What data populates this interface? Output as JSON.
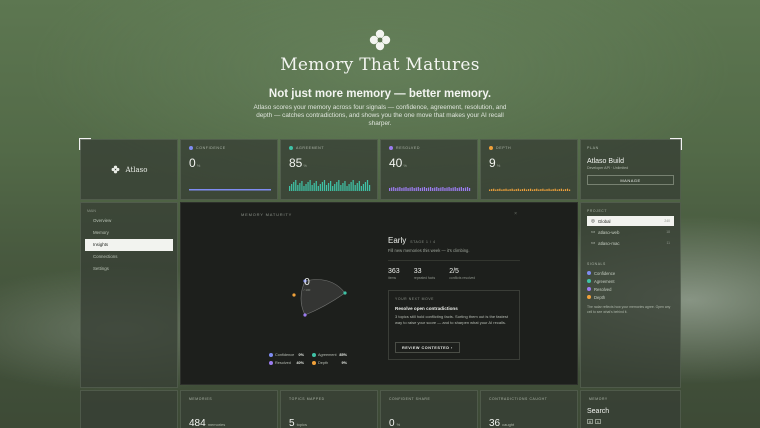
{
  "hero": {
    "title": "Memory That Matures",
    "subtitle": "Not just more memory — better memory.",
    "description": "Atlaso scores your memory across four signals — confidence, agreement, resolution, and depth — catches contradictions, and shows you the one move that makes your AI recall sharper."
  },
  "brand": {
    "name": "Atlaso",
    "logo_icon": "atlaso-logo-icon"
  },
  "metrics": [
    {
      "label": "CONFIDENCE",
      "value": "0",
      "unit": "%",
      "color": "#7f8cf2"
    },
    {
      "label": "AGREEMENT",
      "value": "85",
      "unit": "%",
      "color": "#3fc2a6"
    },
    {
      "label": "RESOLVED",
      "value": "40",
      "unit": "%",
      "color": "#9b7cf0"
    },
    {
      "label": "DEPTH",
      "value": "9",
      "unit": "%",
      "color": "#f0a13a"
    }
  ],
  "plan": {
    "label": "PLAN",
    "name": "Atlaso Build",
    "meta": "Developer API · Unlimited",
    "manage_label": "MANAGE"
  },
  "sidebar": {
    "heading": "MAIN",
    "items": [
      {
        "label": "Overview",
        "active": false
      },
      {
        "label": "Memory",
        "active": false
      },
      {
        "label": "Insights",
        "active": true
      },
      {
        "label": "Connections",
        "active": false
      },
      {
        "label": "Settings",
        "active": false
      }
    ]
  },
  "maturity": {
    "panel_label": "MEMORY MATURITY",
    "score": "0",
    "score_caption": "/ 100",
    "stage": "Early",
    "stage_meta": "STAGE 1 / 4",
    "stage_note": "Fill new memories this week — it's climbing.",
    "stats": [
      {
        "value": "363",
        "label": "items"
      },
      {
        "value": "33",
        "label": "repeated facts"
      },
      {
        "value": "2/5",
        "label": "conflicts resolved"
      }
    ],
    "legend": [
      {
        "name": "Confidence",
        "value": "0%",
        "color": "#7f8cf2"
      },
      {
        "name": "Agreement",
        "value": "85%",
        "color": "#3fc2a6"
      },
      {
        "name": "Resolved",
        "value": "40%",
        "color": "#9b7cf0"
      },
      {
        "name": "Depth",
        "value": "9%",
        "color": "#f0a13a"
      }
    ],
    "next_move": {
      "label": "YOUR NEXT MOVE",
      "title": "Resolve open contradictions",
      "body": "3 topics still hold conflicting facts. Sorting them out is the fastest way to raise your score — and to sharpen what your AI recalls.",
      "button_label": "REVIEW CONTESTED"
    }
  },
  "projects": {
    "label": "PROJECT",
    "items": [
      {
        "label": "Global",
        "count": "240",
        "active": true
      },
      {
        "label": "atlaso-web",
        "count": "18",
        "active": false
      },
      {
        "label": "atlaso-mac",
        "count": "11",
        "active": false
      }
    ]
  },
  "signals": {
    "label": "SIGNALS",
    "items": [
      {
        "name": "Confidence",
        "color": "#7f8cf2"
      },
      {
        "name": "Agreement",
        "color": "#3fc2a6"
      },
      {
        "name": "Resolved",
        "color": "#9b7cf0"
      },
      {
        "name": "Depth",
        "color": "#f0a13a"
      }
    ],
    "note": "The radar reflects how your memories agree. Open any cell to see what's behind it."
  },
  "bottom": [
    {
      "label": "MEMORIES",
      "value": "484",
      "unit": "memories"
    },
    {
      "label": "TOPICS MAPPED",
      "value": "5",
      "unit": "topics"
    },
    {
      "label": "CONFIDENT SHARE",
      "value": "0",
      "unit": "%"
    },
    {
      "label": "CONTRADICTIONS CAUGHT",
      "value": "36",
      "unit": "caught"
    }
  ],
  "search": {
    "label": "MEMORY",
    "title": "Search",
    "keys": [
      "⌘",
      "K"
    ]
  }
}
